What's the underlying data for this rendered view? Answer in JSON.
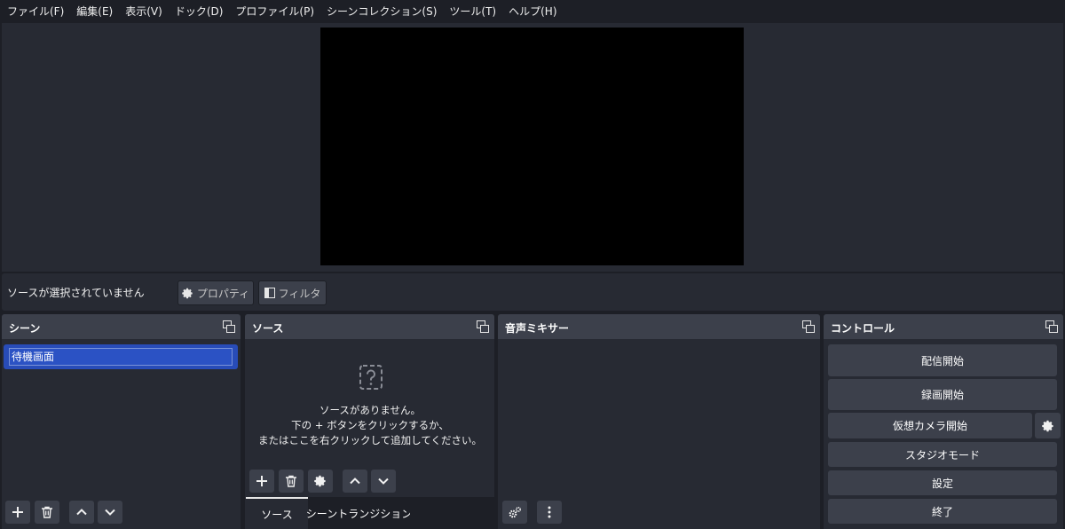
{
  "menu": [
    "ファイル(F)",
    "編集(E)",
    "表示(V)",
    "ドック(D)",
    "プロファイル(P)",
    "シーンコレクション(S)",
    "ツール(T)",
    "ヘルプ(H)"
  ],
  "context_bar": {
    "no_source_label": "ソースが選択されていません",
    "properties_label": "プロパティ",
    "filters_label": "フィルタ"
  },
  "scenes": {
    "title": "シーン",
    "items": [
      "待機画面"
    ]
  },
  "sources": {
    "title": "ソース",
    "empty_lines": [
      "ソースがありません。",
      "下の + ボタンをクリックするか、",
      "またはここを右クリックして追加してください。"
    ],
    "tabs": [
      "ソース",
      "シーントランジション"
    ]
  },
  "mixer": {
    "title": "音声ミキサー"
  },
  "controls": {
    "title": "コントロール",
    "buttons": {
      "start_streaming": "配信開始",
      "start_recording": "録画開始",
      "start_virtualcam": "仮想カメラ開始",
      "studio_mode": "スタジオモード",
      "settings": "設定",
      "exit": "終了"
    }
  },
  "icons": {
    "float": "dock-float-icon",
    "add": "plus-icon",
    "remove": "trash-icon",
    "gear": "gear-icon",
    "up": "chevron-up-icon",
    "down": "chevron-down-icon",
    "menu": "vertical-dots-icon",
    "advanced_audio": "gears-icon",
    "filter": "filter-icon",
    "question": "question-icon"
  },
  "colors": {
    "background": "#1d1f26",
    "panel": "#272a33",
    "button": "#3c404b",
    "selection": "#284cb8"
  }
}
